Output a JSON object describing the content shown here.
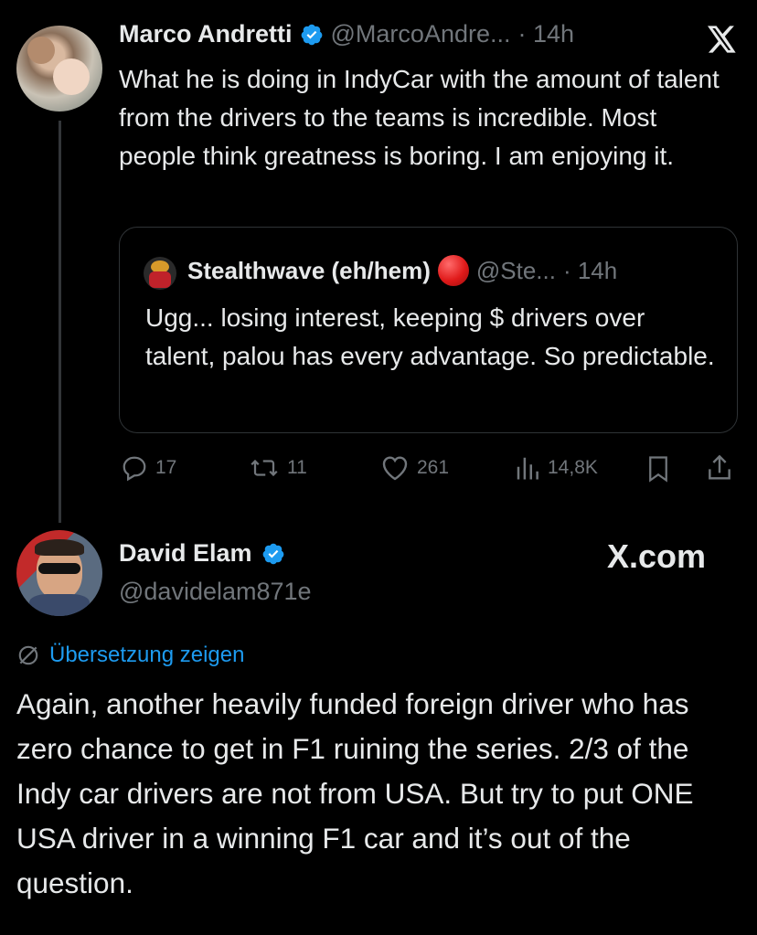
{
  "tweet": {
    "author": {
      "name": "Marco Andretti",
      "handle": "@MarcoAndre...",
      "time": "· 14h"
    },
    "text": "What he is doing in IndyCar with the amount of talent from the drivers to the teams is incredible. Most people think greatness is boring. I am enjoying it.",
    "quote": {
      "name": "Stealthwave (eh/hem)",
      "handle": "@Ste...",
      "time": "· 14h",
      "text": "Ugg... losing interest, keeping $ drivers over talent, palou has every advantage. So predictable."
    },
    "stats": {
      "replies": "17",
      "reposts": "11",
      "likes": "261",
      "views": "14,8K"
    }
  },
  "reply": {
    "author": {
      "name": "David Elam",
      "handle": "@davidelam871e"
    },
    "brand": "X.com",
    "translate_label": "Übersetzung zeigen",
    "text": "Again, another heavily funded foreign driver who has zero chance to get in F1 ruining the series. 2/3 of the Indy car drivers are not from USA. But try to put ONE USA driver in a winning F1 car and it’s out of the question."
  },
  "colors": {
    "verified": "#1d9bf0",
    "link": "#1d9bf0",
    "muted": "#71767b",
    "text": "#e7e9ea",
    "red_dot": "#e01a1a"
  },
  "icons": [
    "x-logo-icon",
    "verified-badge-icon",
    "reply-icon",
    "repost-icon",
    "like-icon",
    "views-icon",
    "bookmark-icon",
    "share-icon",
    "translate-icon",
    "red-circle-icon"
  ]
}
